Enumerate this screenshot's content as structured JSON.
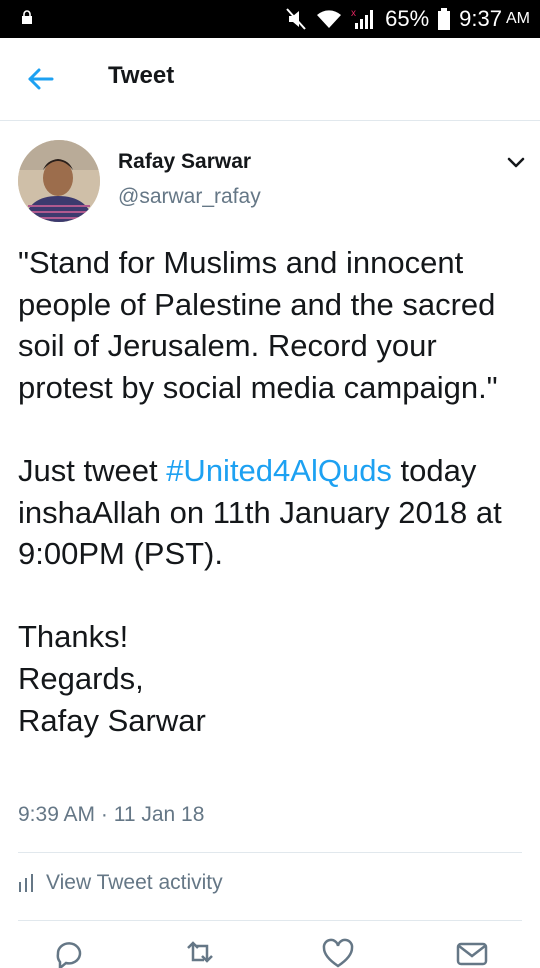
{
  "status_bar": {
    "battery": "65%",
    "time": "9:37",
    "ampm": "AM",
    "icons": [
      "lock-icon",
      "mute-icon",
      "wifi-icon",
      "signal-icon",
      "battery-icon"
    ]
  },
  "header": {
    "title": "Tweet",
    "back_icon": "arrow-left-icon"
  },
  "tweet": {
    "author_name": "Rafay Sarwar",
    "author_handle": "@sarwar_rafay",
    "lines": {
      "p1": "\"Stand for Muslims and innocent people of Palestine and the sacred soil of Jerusalem. Record your protest by social media campaign.\"",
      "p2_before": "Just tweet ",
      "p2_hashtag": "#United4AlQuds",
      "p2_after": " today inshaAllah on 11th January 2018 at 9:00PM (PST).",
      "p3_line1": "Thanks!",
      "p3_line2": "Regards,",
      "p3_line3": "Rafay Sarwar"
    },
    "timestamp": "9:39 AM · 11 Jan 18",
    "activity_label": "View Tweet activity"
  },
  "colors": {
    "accent": "#1da1f2",
    "secondary_text": "#657786",
    "divider": "#e1e8ed"
  }
}
